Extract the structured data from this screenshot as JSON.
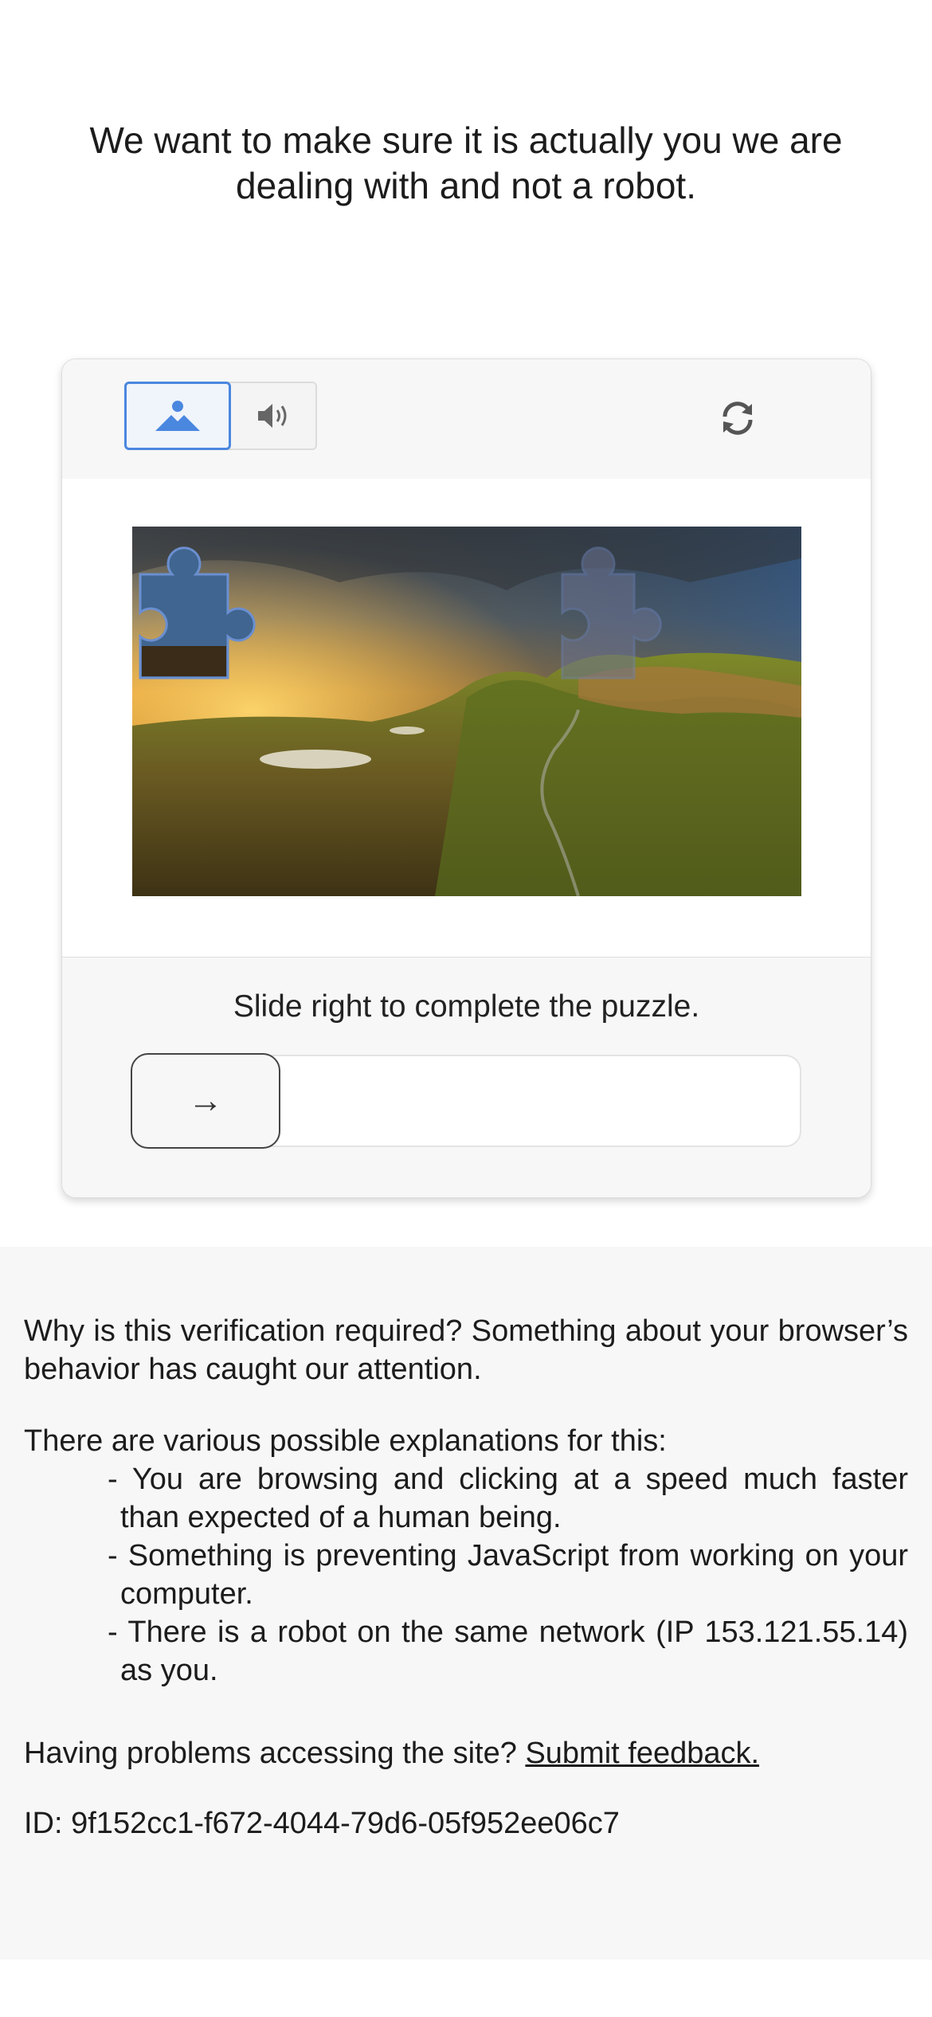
{
  "header": {
    "message": "We want to make sure it is actually you we are dealing with and not a robot."
  },
  "captcha": {
    "modes": [
      {
        "name": "image-mode",
        "icon": "mountain-image-icon",
        "selected": true
      },
      {
        "name": "audio-mode",
        "icon": "speaker-icon",
        "selected": false
      }
    ],
    "refresh_icon": "refresh-icon",
    "instruction": "Slide right to complete the puzzle.",
    "slider_icon": "→",
    "slider_progress": 0,
    "accent_color": "#4a87df"
  },
  "info": {
    "why": "Why is this verification required? Something about your browser’s behavior has caught our attention.",
    "intro": "There are various possible explanations for this:",
    "reasons": [
      "- You are browsing and clicking at a speed much faster than expected of a human being.",
      "- Something is preventing JavaScript from working on your computer.",
      "- There is a robot on the same network (IP 153.121.55.14) as you."
    ],
    "problems_text": "Having problems accessing the site?",
    "feedback_link": "Submit feedback.",
    "id_line": "ID: 9f152cc1-f672-4044-79d6-05f952ee06c7"
  }
}
